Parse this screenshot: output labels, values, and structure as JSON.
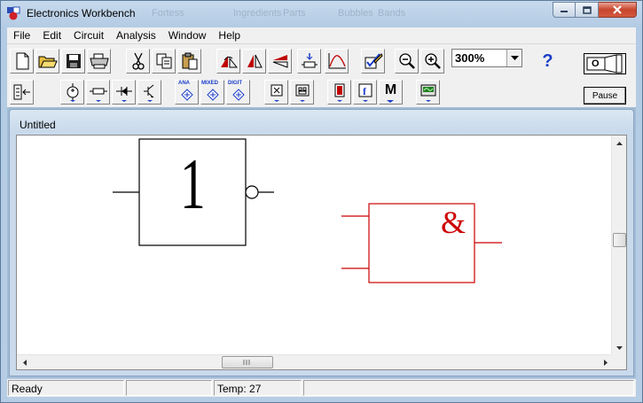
{
  "window": {
    "title": "Electronics Workbench",
    "ghost_menu": [
      "Ingredients",
      "Parts",
      "Bubbles",
      "Bands"
    ],
    "ghost_text": "Fortess"
  },
  "menu": [
    "File",
    "Edit",
    "Circuit",
    "Analysis",
    "Window",
    "Help"
  ],
  "toolbar": {
    "zoom_value": "300%",
    "help_label": "?",
    "pause_label": "Pause",
    "ana_label": "ANA",
    "mixed_label": "MIXED",
    "digit_label": "DIGIT",
    "misc_label": "M",
    "power_switch_label": "O"
  },
  "document": {
    "title": "Untitled",
    "gates": [
      {
        "symbol": "1",
        "color": "#000000"
      },
      {
        "symbol": "&",
        "color": "#cc0000"
      }
    ]
  },
  "status": {
    "ready": "Ready",
    "temp_label": "Temp:",
    "temp_value": "27"
  },
  "colors": {
    "accent_red": "#cc0000",
    "help_blue": "#1a3cc8"
  }
}
